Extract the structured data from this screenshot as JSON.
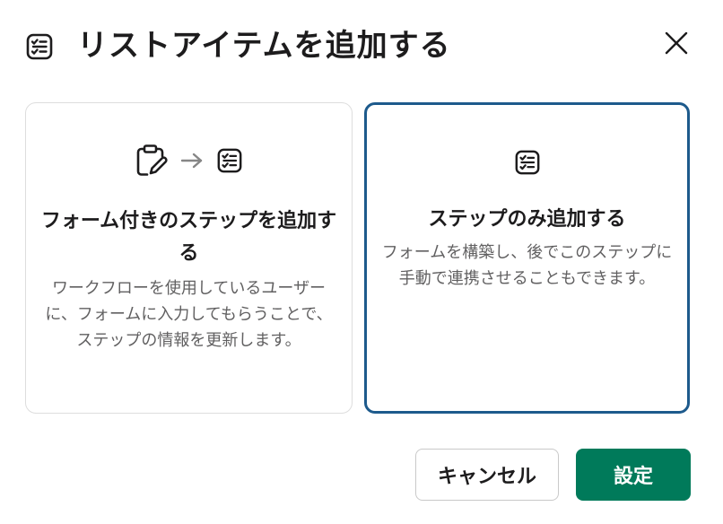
{
  "dialog": {
    "title": "リストアイテムを追加する",
    "title_icon": "checklist-icon",
    "close_icon": "close-icon"
  },
  "options": [
    {
      "title": "フォーム付きのステップを追加する",
      "description": "ワークフローを使用しているユーザーに、フォームに入力してもらうことで、ステップの情報を更新します。",
      "icons": [
        "clipboard-edit-icon",
        "arrow-right-icon",
        "checklist-icon"
      ],
      "selected": false
    },
    {
      "title": "ステップのみ追加する",
      "description": "フォームを構築し、後でこのステップに手動で連携させることもできます。",
      "icons": [
        "checklist-icon"
      ],
      "selected": true
    }
  ],
  "footer": {
    "cancel_label": "キャンセル",
    "confirm_label": "設定"
  },
  "colors": {
    "selected_border": "#1d5a8c",
    "primary_button": "#007a5a"
  }
}
